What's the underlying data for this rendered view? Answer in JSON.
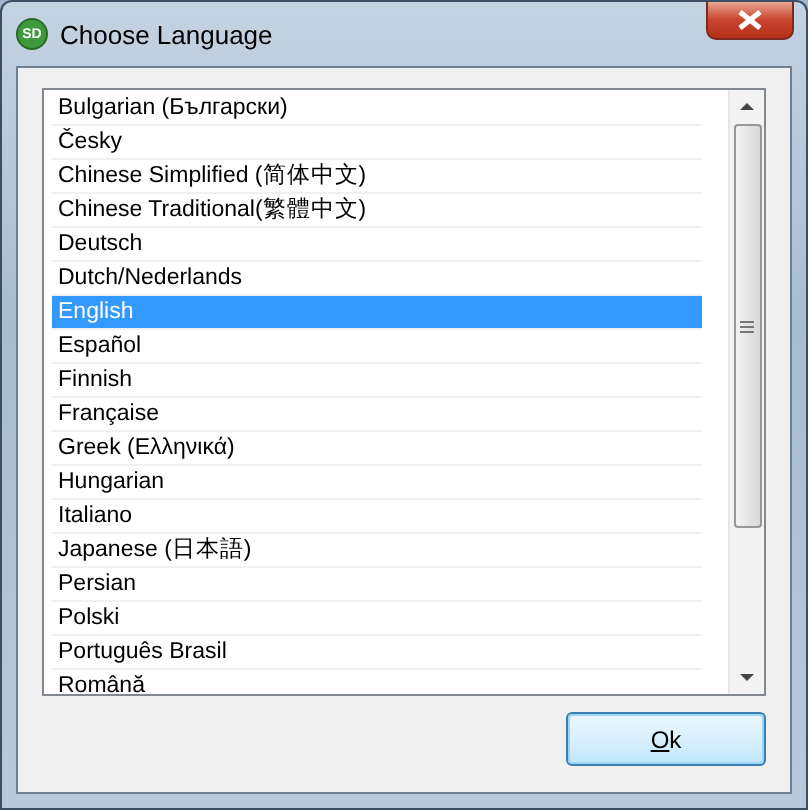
{
  "window": {
    "title": "Choose Language",
    "icon_text": "SD"
  },
  "languages": [
    {
      "label": "Bulgarian (Български)",
      "selected": false
    },
    {
      "label": "Česky",
      "selected": false
    },
    {
      "label": "Chinese Simplified (简体中文)",
      "selected": false
    },
    {
      "label": "Chinese Traditional(繁體中文)",
      "selected": false
    },
    {
      "label": "Deutsch",
      "selected": false
    },
    {
      "label": "Dutch/Nederlands",
      "selected": false
    },
    {
      "label": "English",
      "selected": true
    },
    {
      "label": "Español",
      "selected": false
    },
    {
      "label": "Finnish",
      "selected": false
    },
    {
      "label": "Française",
      "selected": false
    },
    {
      "label": "Greek (Ελληνικά)",
      "selected": false
    },
    {
      "label": "Hungarian",
      "selected": false
    },
    {
      "label": "Italiano",
      "selected": false
    },
    {
      "label": "Japanese (日本語)",
      "selected": false
    },
    {
      "label": "Persian",
      "selected": false
    },
    {
      "label": "Polski",
      "selected": false
    },
    {
      "label": "Português Brasil",
      "selected": false
    },
    {
      "label": "Română",
      "selected": false
    }
  ],
  "buttons": [
    {
      "label": "Ok"
    }
  ]
}
